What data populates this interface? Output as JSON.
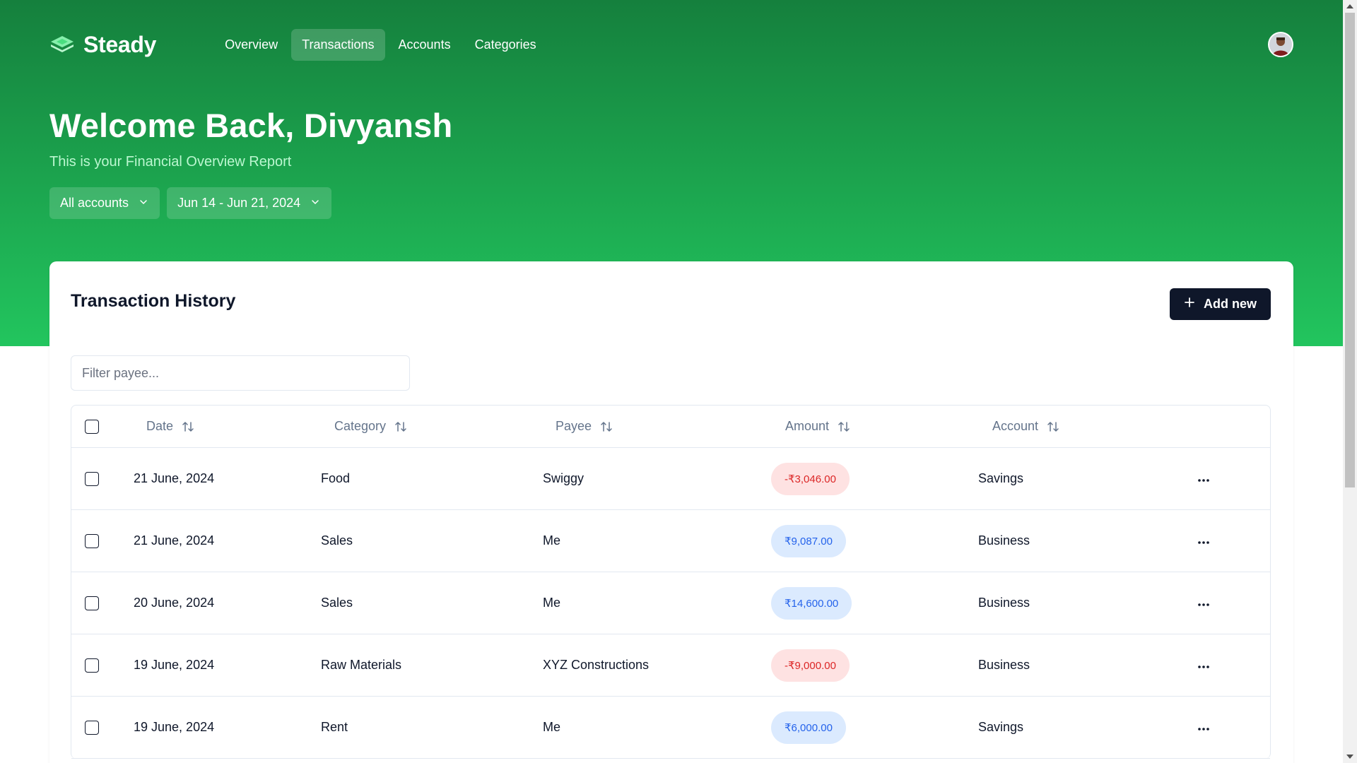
{
  "brand": {
    "name": "Steady"
  },
  "nav": {
    "items": [
      {
        "label": "Overview",
        "active": false
      },
      {
        "label": "Transactions",
        "active": true
      },
      {
        "label": "Accounts",
        "active": false
      },
      {
        "label": "Categories",
        "active": false
      }
    ]
  },
  "hero": {
    "welcome": "Welcome Back, Divyansh",
    "subtitle": "This is your Financial Overview Report"
  },
  "filters": {
    "accounts": "All accounts",
    "date_range": "Jun 14 - Jun 21, 2024"
  },
  "card": {
    "title": "Transaction History",
    "add_label": "Add new",
    "filter_placeholder": "Filter payee...",
    "columns": [
      "Date",
      "Category",
      "Payee",
      "Amount",
      "Account"
    ],
    "rows": [
      {
        "date": "21 June, 2024",
        "category": "Food",
        "payee": "Swiggy",
        "amount": "-₹3,046.00",
        "type": "neg",
        "account": "Savings"
      },
      {
        "date": "21 June, 2024",
        "category": "Sales",
        "payee": "Me",
        "amount": "₹9,087.00",
        "type": "pos",
        "account": "Business"
      },
      {
        "date": "20 June, 2024",
        "category": "Sales",
        "payee": "Me",
        "amount": "₹14,600.00",
        "type": "pos",
        "account": "Business"
      },
      {
        "date": "19 June, 2024",
        "category": "Raw Materials",
        "payee": "XYZ Constructions",
        "amount": "-₹9,000.00",
        "type": "neg",
        "account": "Business"
      },
      {
        "date": "19 June, 2024",
        "category": "Rent",
        "payee": "Me",
        "amount": "₹6,000.00",
        "type": "pos",
        "account": "Savings"
      }
    ]
  },
  "colors": {
    "hero_top": "#15803d",
    "hero_bottom": "#22c55e",
    "negative": "#dc2626",
    "positive": "#2563eb",
    "button_dark": "#0f172a"
  },
  "icons": {
    "logo": "stack-layers-icon",
    "chevron": "chevron-down-icon",
    "sort": "sort-arrows-icon",
    "add": "plus-icon",
    "more": "more-horizontal-icon"
  }
}
